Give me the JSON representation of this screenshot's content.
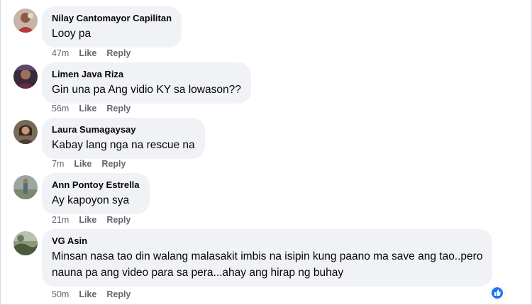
{
  "comments": [
    {
      "author": "Nilay Cantomayor Capilitan",
      "text": "Looy pa",
      "time": "47m",
      "like": "Like",
      "reply": "Reply"
    },
    {
      "author": "Limen Java Riza",
      "text": "Gin una pa Ang vidio KY sa lowason??",
      "time": "56m",
      "like": "Like",
      "reply": "Reply"
    },
    {
      "author": "Laura Sumagaysay",
      "text": "Kabay lang nga na rescue na",
      "time": "7m",
      "like": "Like",
      "reply": "Reply"
    },
    {
      "author": "Ann Pontoy Estrella",
      "text": "Ay kapoyon sya",
      "time": "21m",
      "like": "Like",
      "reply": "Reply"
    },
    {
      "author": "VG Asin",
      "text_line1": "Minsan nasa tao din walang malasakit imbis na isipin kung paano ma save ang tao..pero",
      "text_line2": "nauna pa ang video para sa pera...ahay ang hirap ng buhay",
      "time": "50m",
      "like": "Like",
      "reply": "Reply",
      "reaction_icon": "like-reaction-icon"
    }
  ],
  "colors": {
    "bubble": "#f0f2f5",
    "meta": "#65676b",
    "accent": "#1877f2"
  }
}
